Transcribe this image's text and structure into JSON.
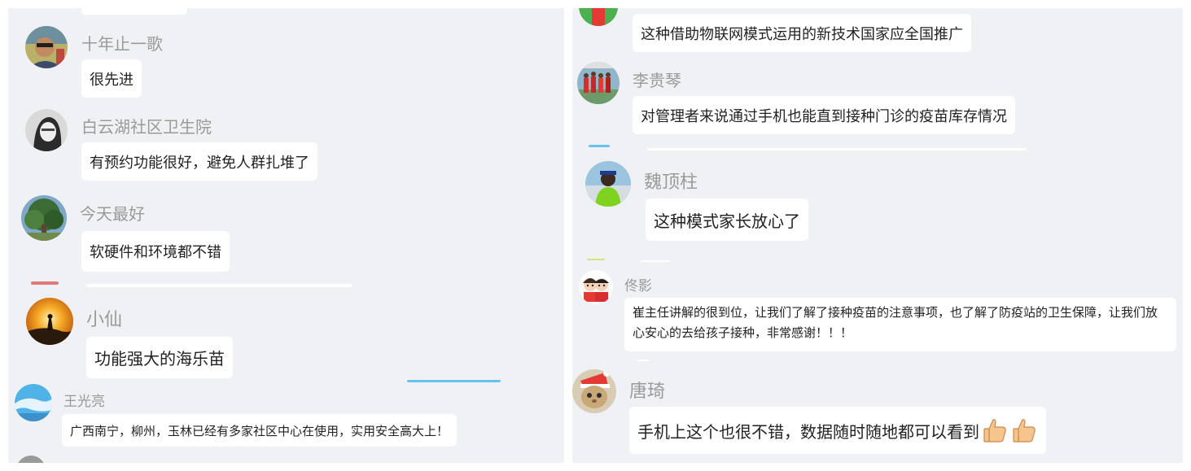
{
  "left_feed": [
    {
      "user": "十年止一歌",
      "message": "很先进",
      "avatar_icon": "avatar-photo-person-sunglasses"
    },
    {
      "user": "白云湖社区卫生院",
      "message": "有预约功能很好，避免人群扎堆了",
      "avatar_icon": "avatar-photo-grayscale-portrait"
    },
    {
      "user": "今天最好",
      "message": "软硬件和环境都不错",
      "avatar_icon": "avatar-photo-tree"
    },
    {
      "user": "小仙",
      "message": "功能强大的海乐苗",
      "avatar_icon": "avatar-photo-sunset-silhouette"
    },
    {
      "user": "王光亮",
      "message": "广西南宁，柳州，玉林已经有多家社区中心在使用，实用安全高大上！",
      "avatar_icon": "avatar-photo-sky"
    }
  ],
  "right_feed": [
    {
      "user": "",
      "message": "这种借助物联网模式运用的新技术国家应全国推广",
      "avatar_icon": "avatar-photo-green-partial"
    },
    {
      "user": "李贵琴",
      "message": "对管理者来说通过手机也能直到接种门诊的疫苗库存情况",
      "avatar_icon": "avatar-photo-group-red"
    },
    {
      "user": "魏顶柱",
      "message": "这种模式家长放心了",
      "avatar_icon": "avatar-photo-person-green-jacket"
    },
    {
      "user": "佟影",
      "message": "崔主任讲解的很到位，让我们了解了接种疫苗的注意事项，也了解了防疫站的卫生保障，让我们放心安心的去给孩子接种，非常感谢！！！",
      "avatar_icon": "avatar-cartoon-couple"
    },
    {
      "user": "唐琦",
      "message": "手机上这个也很不错，数据随时随地都可以看到",
      "avatar_icon": "avatar-photo-cat-santa-hat",
      "emoji": [
        "thumbs-up-icon",
        "thumbs-up-icon"
      ]
    }
  ],
  "colors": {
    "background": "#f0f1f4",
    "bubble": "#ffffff",
    "username": "#9a9a9a",
    "message_text": "#222222"
  }
}
